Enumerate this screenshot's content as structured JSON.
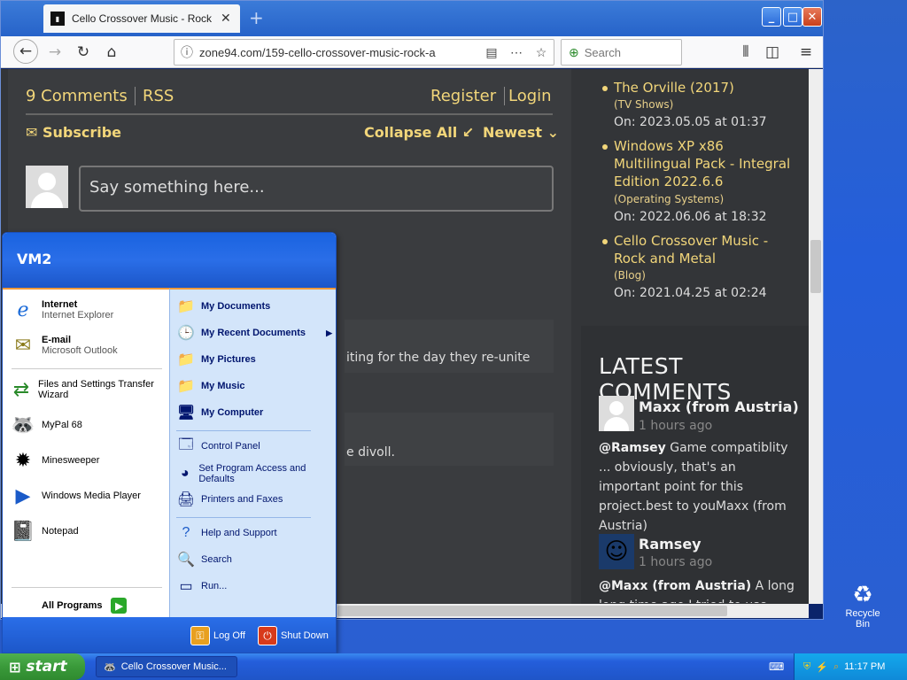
{
  "browser": {
    "tab_title": "Cello Crossover Music - Rock and M",
    "url": "zone94.com/159-cello-crossover-music-rock-a",
    "search_placeholder": "Search",
    "window_buttons": {
      "min": "_",
      "max": "□",
      "close": "✕"
    }
  },
  "page": {
    "comments_count": "9 Comments",
    "rss": "RSS",
    "register": "Register",
    "login": "Login",
    "subscribe": "✉ Subscribe",
    "collapse_all": "Collapse All ↙",
    "newest": "Newest ⌄",
    "say_placeholder": "Say something here...",
    "comment_snippet_1": "iting for the day they re-unite",
    "comment_snippet_2": "e divoll."
  },
  "sidebar": {
    "recent": [
      {
        "title": "The Orville (2017)",
        "category": "(TV Shows)",
        "on": "On: 2023.05.05 at 01:37"
      },
      {
        "title": "Windows XP x86 Multilingual Pack - Integral Edition 2022.6.6",
        "category": "(Operating Systems)",
        "on": "On: 2022.06.06 at 18:32"
      },
      {
        "title": "Cello Crossover Music - Rock and Metal",
        "category": "(Blog)",
        "on": "On: 2021.04.25 at 02:24"
      }
    ],
    "latest_comments_heading": "LATEST COMMENTS",
    "comments": [
      {
        "name": "Maxx (from Austria)",
        "time": "1 hours ago",
        "mention": "@Ramsey",
        "text": " Game compatiblity ... obviously, that's an important point for this project.best to youMaxx (from Austria)"
      },
      {
        "name": "Ramsey",
        "time": "1 hours ago",
        "mention": "@Maxx (from Austria)",
        "text": " A long long time ago I tried to use"
      }
    ]
  },
  "start_menu": {
    "user": "VM2",
    "left_items": [
      {
        "label": "Internet",
        "sub": "Internet Explorer"
      },
      {
        "label": "E-mail",
        "sub": "Microsoft Outlook"
      },
      {
        "label": "Files and Settings Transfer Wizard"
      },
      {
        "label": "MyPal 68"
      },
      {
        "label": "Minesweeper"
      },
      {
        "label": "Windows Media Player"
      },
      {
        "label": "Notepad"
      }
    ],
    "all_programs": "All Programs",
    "right_items": [
      "My Documents",
      "My Recent Documents",
      "My Pictures",
      "My Music",
      "My Computer",
      "Control Panel",
      "Set Program Access and Defaults",
      "Printers and Faxes",
      "Help and Support",
      "Search",
      "Run..."
    ],
    "log_off": "Log Off",
    "shut_down": "Shut Down"
  },
  "taskbar": {
    "start": "start",
    "task_title": "Cello Crossover Music...",
    "clock": "11:17 PM"
  },
  "desktop": {
    "recycle_bin": "Recycle Bin"
  }
}
